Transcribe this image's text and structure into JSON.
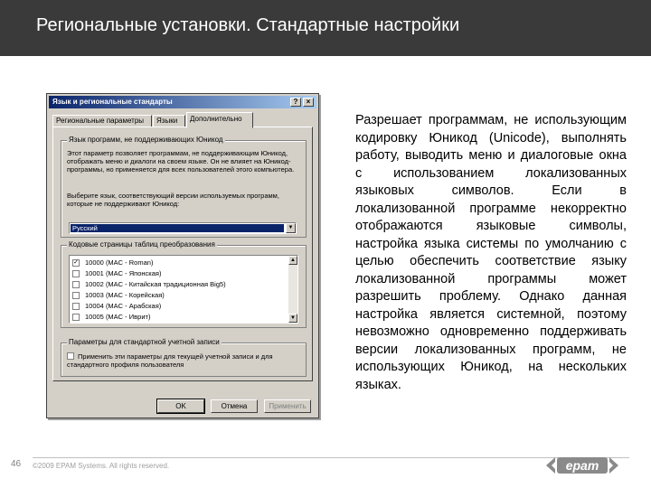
{
  "slide": {
    "title": "Региональные установки. Стандартные настройки",
    "description": "Разрешает программам, не использующим кодировку Юникод (Unicode), выполнять работу, выводить меню и диалоговые окна с использованием локализованных языковых символов. Если в локализованной программе некорректно отображаются языковые символы, настройка языка системы по умолчанию с целью обеспечить соответствие языку локализованной программы может разрешить проблему. Однако данная настройка является системной, поэтому невозможно одновременно поддерживать версии локализованных программ, не использующих Юникод, на нескольких языках.",
    "page_number": "46",
    "copyright": "©2009 EPAM Systems. All rights reserved.",
    "logo_text": "epam"
  },
  "dialog": {
    "title": "Язык и региональные стандарты",
    "help_label": "?",
    "close_label": "×",
    "tabs": [
      "Региональные параметры",
      "Языки",
      "Дополнительно"
    ],
    "group_nonunicode": {
      "legend": "Язык программ, не поддерживающих Юникод",
      "text1": "Этот параметр позволяет программам, не поддерживающим Юникод, отображать меню и диалоги на своем языке. Он не влияет на Юникод-программы, но применяется для всех пользователей этого компьютера.",
      "text2": "Выберите язык, соответствующий версии используемых программ, которые не поддерживают Юникод:",
      "selected": "Русский"
    },
    "group_codepages": {
      "legend": "Кодовые страницы таблиц преобразования",
      "items": [
        {
          "label": "10000 (MAC - Roman)",
          "checked": true
        },
        {
          "label": "10001 (MAC - Японская)",
          "checked": false
        },
        {
          "label": "10002 (MAC - Китайская традиционная Big5)",
          "checked": false
        },
        {
          "label": "10003 (MAC - Корейская)",
          "checked": false
        },
        {
          "label": "10004 (MAC - Арабская)",
          "checked": false
        },
        {
          "label": "10005 (MAC - Иврит)",
          "checked": false
        }
      ]
    },
    "group_default": {
      "legend": "Параметры для стандартной учетной записи",
      "checkbox_label": "Применить эти параметры для текущей учетной записи и для стандартного профиля пользователя"
    },
    "buttons": {
      "ok": "OK",
      "cancel": "Отмена",
      "apply": "Применить"
    }
  }
}
